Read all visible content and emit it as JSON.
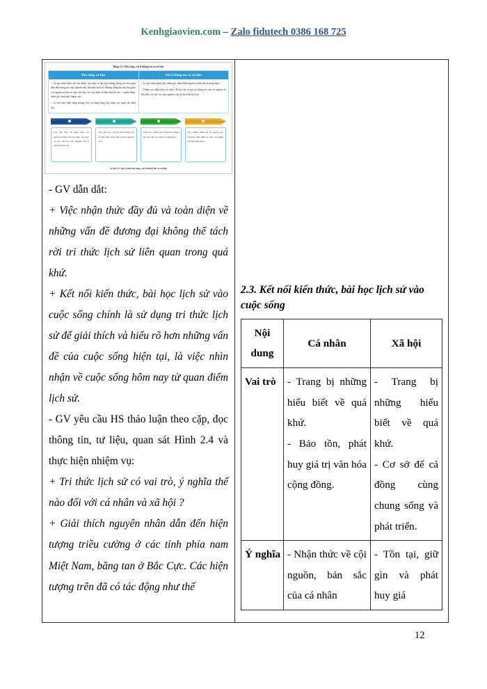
{
  "header": {
    "site": "Kenhgiaovien.com",
    "separator": " – ",
    "zalo": "Zalo fidutech 0386 168 725"
  },
  "figure": {
    "caption_top": "Bảng 2.2. Thu thập, xử lí thông tin và sử liệu",
    "caption_bottom": "Sơ đồ 2.2. Quy trình thu thập, xử lí thông tin và sử liệu",
    "columns": [
      {
        "header": "Thu thập sử liệu",
        "paragraphs": [
          "– Là quá trình khảo sát, tìm kiếm, sưu tầm và tập hợp những thông tin liên quan đến đối tượng học tập, nghiên cứu, tìm hiểu lịch sử. Những thông tin này bao gồm các nguồn sử liệu sơ cấp, thứ cấp; các loại hình sử liệu như lời nói – truyền khẩu, hiện vật, hình ảnh, thành văn,...",
          "– Có thể thực hiện bằng phỏng vấn, sử dụng bảng hỏi, khảo sát, quan sát, điền dã,..."
        ]
      },
      {
        "header": "Xử lí thông tin và sử liệu",
        "paragraphs": [
          "– Là quá trình phân loại, đánh giá, thẩm định nguồn sử liệu đã thu thập được.",
          "– Nhằm xác định tính xác thực, độ tin cậy và giá trị thông tin của các nguồn sử liệu đối với việc học tập, nghiên cứu và tìm hiểu lịch sử."
        ]
      }
    ],
    "flow_steps": [
      {
        "color": "#15437f",
        "text": "Lập thư mục và danh mục các nguồn sử liệu cần thu thập, để phục vụ cho việc học tập, nghiên cứu và tìm hiểu lịch sử."
      },
      {
        "color": "#1b9c8b",
        "text": "Sưu tầm, đọc và ghi chép thông tin sử liệu liên quan đến vấn đề nghiên cứu."
      },
      {
        "color": "#1f8c2c",
        "text": "Chọn lọc, phân loại sử liệu để thuận lợi cho việc xác minh và đánh giá."
      },
      {
        "color": "#d99420",
        "text": "Xác minh, đánh giá về nguồn gốc sử liệu, thời điểm ra đời, nội dung sử liệu phản ánh,..."
      }
    ]
  },
  "left_column": {
    "paragraphs": [
      {
        "text": "- GV dẫn dắt:",
        "italic": false
      },
      {
        "text": "+ Việc nhận thức đầy đủ và toàn diện về những vấn đề đương đại không thể tách rời tri thức lịch sử liên quan trong quá khứ.",
        "italic": true
      },
      {
        "text": "+ Kết nối kiến thức, bài học lịch sử vào cuộc sống chính là sử dụng tri thức lịch sử để giải thích và hiểu rõ hơn những vấn đề của cuộc sống hiện tại, là việc nhìn nhận về cuộc sống hôm nay từ quan điểm lịch sử.",
        "italic": true
      },
      {
        "text": "- GV yêu cầu HS thảo luận theo cặp, đọc thông tin, tư liệu, quan sát Hình 2.4 và thực hiện nhiệm vụ:",
        "italic": false
      },
      {
        "text": "+ Tri thức lịch sử có vai trò, ý nghĩa thế nào đối với cá nhân và xã hội ?",
        "italic": true
      },
      {
        "text": "+ Giải thích nguyên nhân dẫn đến hiện tượng triều cường ở các tỉnh phía nam Miệt Nam, băng tan ở Bắc Cực. Các hiện tượng trên đã có tác động như thế",
        "italic": true
      }
    ]
  },
  "right_column": {
    "heading": "2.3. Kết nối kiến thức, bài học lịch sử vào cuộc sống",
    "table": {
      "headers": [
        "Nội dung",
        "Cá nhân",
        "Xã hội"
      ],
      "rows": [
        {
          "label": "Vai trò",
          "ca_nhan": [
            "- Trang bị những hiểu biết về quá khứ.",
            "- Bảo tồn, phát huy giá trị văn hóa cộng đồng."
          ],
          "xa_hoi": [
            "- Trang bị những hiểu biết về quá khứ.",
            "- Cơ sở để cả đồng cùng chung sống và phát triển."
          ]
        },
        {
          "label": "Ý nghĩa",
          "ca_nhan": [
            "- Nhận thức về cội nguồn, bản sắc của cá nhân"
          ],
          "xa_hoi": [
            "- Tồn tại, giữ gìn và phát huy giá"
          ]
        }
      ]
    }
  },
  "footer": {
    "page_number": "12"
  }
}
